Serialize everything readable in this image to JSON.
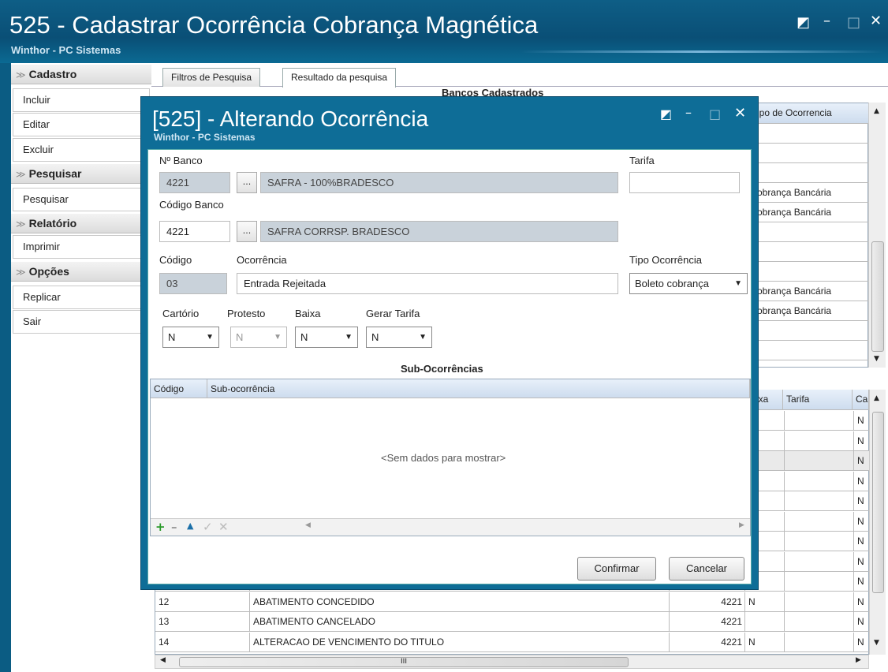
{
  "window": {
    "title": "525 - Cadastrar Ocorrência Cobrança Magnética",
    "subtitle": "Winthor - PC Sistemas"
  },
  "sidebar": {
    "sections": [
      {
        "label": "Cadastro",
        "items": [
          "Incluir",
          "Editar",
          "Excluir"
        ]
      },
      {
        "label": "Pesquisar",
        "items": [
          "Pesquisar"
        ]
      },
      {
        "label": "Relatório",
        "items": [
          "Imprimir"
        ]
      },
      {
        "label": "Opções",
        "items": [
          "Replicar",
          "Sair"
        ]
      }
    ]
  },
  "tabs": [
    "Filtros de Pesquisa",
    "Resultado da pesquisa"
  ],
  "bancos_title": "Bancos Cadastrados",
  "top_grid": {
    "header": "ipo de Ocorrencia",
    "rows": [
      "",
      "",
      "",
      "obrança Bancária",
      "obrança Bancária",
      "",
      "",
      "",
      "obrança Bancária",
      "obrança Bancária",
      "",
      ""
    ]
  },
  "bottom_grid": {
    "headers": [
      "ixa",
      "Tarifa",
      "Ca"
    ],
    "rows": [
      {
        "codigo": "",
        "desc": "",
        "banco": "",
        "baixa": "",
        "ca": "N"
      },
      {
        "codigo": "",
        "desc": "",
        "banco": "",
        "baixa": "",
        "ca": "N"
      },
      {
        "codigo": "",
        "desc": "",
        "banco": "",
        "baixa": "",
        "ca": "N"
      },
      {
        "codigo": "",
        "desc": "",
        "banco": "",
        "baixa": "",
        "ca": "N"
      },
      {
        "codigo": "",
        "desc": "",
        "banco": "",
        "baixa": "",
        "ca": "N"
      },
      {
        "codigo": "",
        "desc": "",
        "banco": "",
        "baixa": "",
        "ca": "N"
      },
      {
        "codigo": "",
        "desc": "",
        "banco": "",
        "baixa": "",
        "ca": "N"
      },
      {
        "codigo": "",
        "desc": "",
        "banco": "",
        "baixa": "",
        "ca": "N"
      },
      {
        "codigo": "",
        "desc": "",
        "banco": "",
        "baixa": "",
        "ca": "N"
      },
      {
        "codigo": "12",
        "desc": "ABATIMENTO CONCEDIDO",
        "banco": "4221",
        "baixa": "N",
        "ca": "N"
      },
      {
        "codigo": "13",
        "desc": "ABATIMENTO CANCELADO",
        "banco": "4221",
        "baixa": "",
        "ca": "N"
      },
      {
        "codigo": "14",
        "desc": "ALTERACAO DE VENCIMENTO DO TITULO",
        "banco": "4221",
        "baixa": "N",
        "ca": "N"
      }
    ],
    "hscroll_label": "III"
  },
  "dialog": {
    "title": "[525] - Alterando Ocorrência",
    "subtitle": "Winthor - PC Sistemas",
    "fields": {
      "nbanco_label": "Nº Banco",
      "nbanco_value": "4221",
      "nbanco_desc": "SAFRA - 100%BRADESCO",
      "tarifa_label": "Tarifa",
      "tarifa_value": "",
      "codbanco_label": "Código Banco",
      "codbanco_value": "4221",
      "codbanco_desc": "SAFRA CORRSP. BRADESCO",
      "codigo_label": "Código",
      "codigo_value": "03",
      "ocorrencia_label": "Ocorrência",
      "ocorrencia_value": "Entrada Rejeitada",
      "tipo_label": "Tipo Ocorrência",
      "tipo_value": "Boleto cobrança",
      "cartorio_label": "Cartório",
      "cartorio_value": "N",
      "protesto_label": "Protesto",
      "protesto_value": "N",
      "baixa_label": "Baixa",
      "baixa_value": "N",
      "gerar_label": "Gerar Tarifa",
      "gerar_value": "N",
      "dots": "..."
    },
    "sub_title": "Sub-Ocorrências",
    "sub_headers": [
      "Código",
      "Sub-ocorrência"
    ],
    "empty_text": "<Sem dados para mostrar>",
    "confirm_label": "Confirmar",
    "cancel_label": "Cancelar"
  },
  "colors": {
    "titlebar": "#0b5c83",
    "dialog_frame": "#0e6d97",
    "add_icon": "#2a9a2a",
    "readonly": "#c9d2da"
  }
}
